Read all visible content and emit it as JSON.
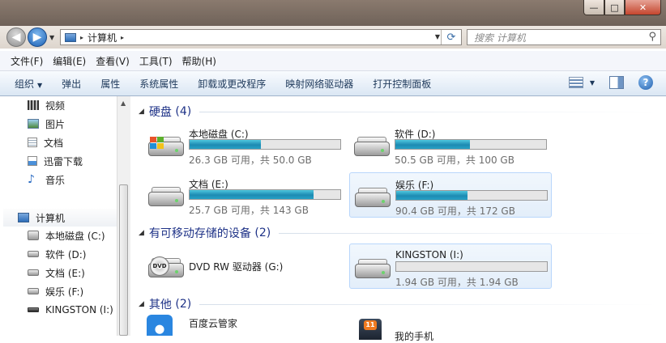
{
  "window": {
    "min_glyph": "—",
    "max_glyph": "□",
    "close_glyph": "✕"
  },
  "nav": {
    "back_glyph": "◀",
    "forward_glyph": "▶",
    "history_glyph": "▼"
  },
  "address": {
    "crumbs": [
      "计算机"
    ],
    "sep_glyph": "▸",
    "dropdown_glyph": "▼",
    "refresh_glyph": "⟳"
  },
  "search": {
    "placeholder": "搜索 计算机",
    "icon_glyph": "⚲"
  },
  "menu": {
    "items": [
      "文件(F)",
      "编辑(E)",
      "查看(V)",
      "工具(T)",
      "帮助(H)"
    ]
  },
  "toolbar": {
    "items": [
      "组织",
      "弹出",
      "属性",
      "系统属性",
      "卸载或更改程序",
      "映射网络驱动器",
      "打开控制面板"
    ],
    "organize_arrow": "▼",
    "view_dd": "▼",
    "help": "?"
  },
  "sidebar": {
    "libraries": [
      "视频",
      "图片",
      "文档",
      "迅雷下载",
      "音乐"
    ],
    "computer": "计算机",
    "drives": [
      "本地磁盘 (C:)",
      "软件 (D:)",
      "文档 (E:)",
      "娱乐 (F:)",
      "KINGSTON (I:)"
    ]
  },
  "scroll": {
    "up_glyph": "▲",
    "grip_glyph": "≡"
  },
  "groups": {
    "hard_disks": {
      "label": "硬盘",
      "count": "(4)"
    },
    "removable": {
      "label": "有可移动存储的设备",
      "count": "(2)"
    },
    "other": {
      "label": "其他",
      "count": "(2)"
    },
    "collapse_glyph": "◢"
  },
  "drives": [
    {
      "name": "本地磁盘 (C:)",
      "free": "26.3 GB 可用，共 50.0 GB",
      "used_fraction": 0.474
    },
    {
      "name": "软件 (D:)",
      "free": "50.5 GB 可用，共 100 GB",
      "used_fraction": 0.495
    },
    {
      "name": "文档 (E:)",
      "free": "25.7 GB 可用，共 143 GB",
      "used_fraction": 0.82
    },
    {
      "name": "娱乐 (F:)",
      "free": "90.4 GB 可用，共 172 GB",
      "used_fraction": 0.474
    }
  ],
  "removable": [
    {
      "name": "DVD RW 驱动器 (G:)",
      "dvd_badge": "DVD"
    },
    {
      "name": "KINGSTON (I:)",
      "free": "1.94 GB 可用，共 1.94 GB",
      "used_fraction": 0.0
    }
  ],
  "others": [
    {
      "name": "百度云管家"
    },
    {
      "name": "我的手机",
      "badge": "11"
    }
  ],
  "colors": {
    "bar_fill": "#1d8ab2",
    "group_text": "#1e3287",
    "selection": "#e3eefa",
    "title_bar": "#7b6d63"
  }
}
